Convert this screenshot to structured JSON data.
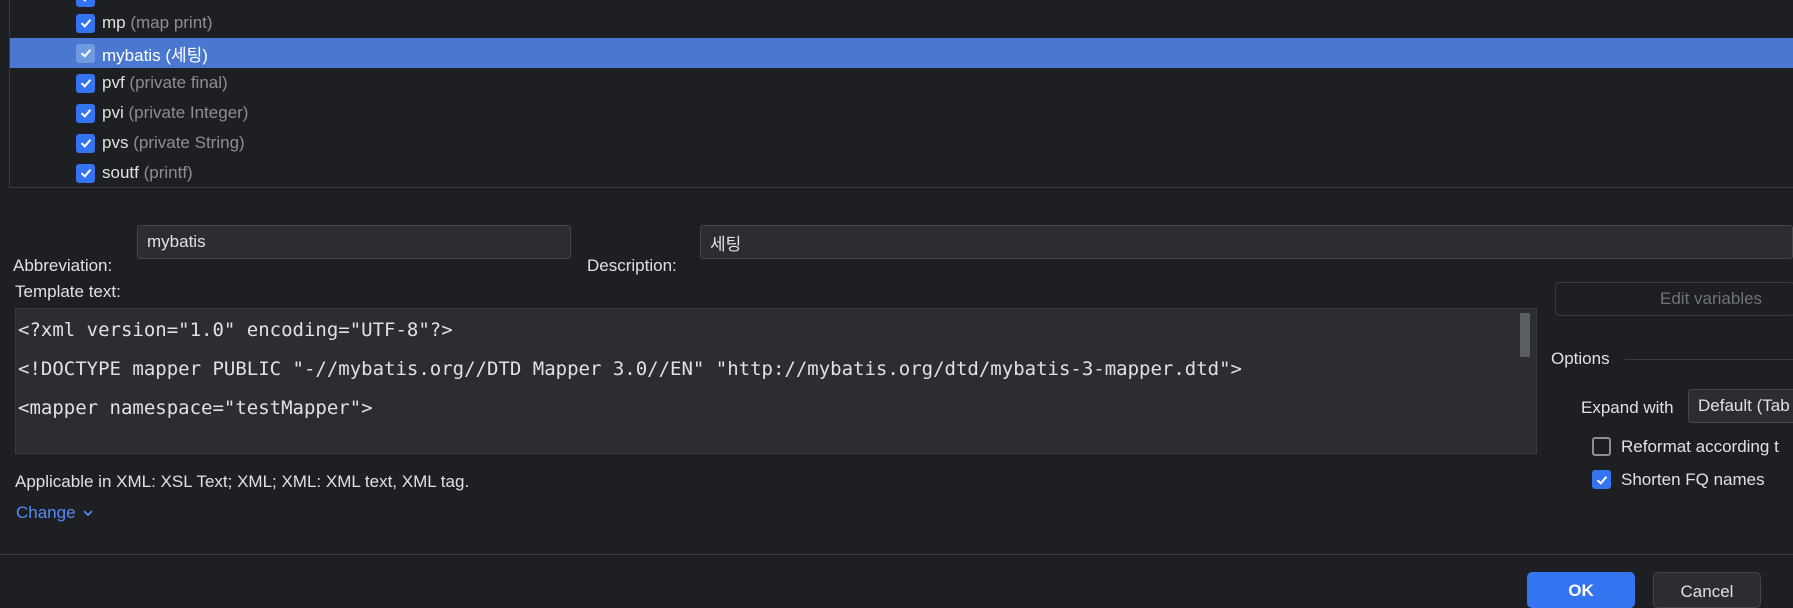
{
  "templates": [
    {
      "abbreviation": "mp",
      "description": "(map print)",
      "checked": true,
      "selected": false
    },
    {
      "abbreviation": "mybatis",
      "description": "(세팅)",
      "checked": true,
      "selected": true
    },
    {
      "abbreviation": "pvf",
      "description": "(private final)",
      "checked": true,
      "selected": false
    },
    {
      "abbreviation": "pvi",
      "description": "(private Integer)",
      "checked": true,
      "selected": false
    },
    {
      "abbreviation": "pvs",
      "description": "(private String)",
      "checked": true,
      "selected": false
    },
    {
      "abbreviation": "soutf",
      "description": "(printf)",
      "checked": true,
      "selected": false
    }
  ],
  "form": {
    "abbreviation_label": "Abbreviation:",
    "abbreviation_value": "mybatis",
    "description_label": "Description:",
    "description_value": "세팅",
    "template_text_label": "Template text:"
  },
  "template_text": [
    "<?xml version=\"1.0\" encoding=\"UTF-8\"?>",
    "<!DOCTYPE mapper PUBLIC \"-//mybatis.org//DTD Mapper 3.0//EN\" \"http://mybatis.org/dtd/mybatis-3-mapper.dtd\">",
    "<mapper namespace=\"testMapper\">"
  ],
  "context": {
    "applicable_text": "Applicable in XML: XSL Text; XML; XML: XML text, XML tag.",
    "change_label": "Change"
  },
  "options": {
    "edit_variables_label": "Edit variables",
    "title": "Options",
    "expand_with_label": "Expand with",
    "expand_with_value": "Default (Tab",
    "reformat_label": "Reformat according t",
    "reformat_checked": false,
    "shorten_label": "Shorten FQ names",
    "shorten_checked": true
  },
  "buttons": {
    "ok_label": "OK",
    "cancel_label": "Cancel"
  },
  "colors": {
    "background": "#1e1f22",
    "selection": "#4a78d0",
    "accent": "#3574f0",
    "link": "#548af7"
  }
}
